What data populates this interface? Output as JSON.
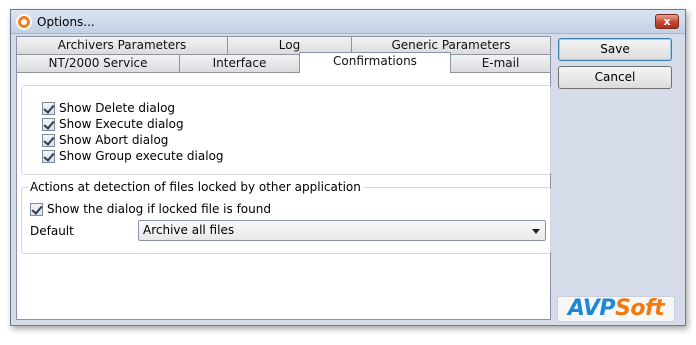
{
  "window": {
    "title": "Options...",
    "close_label": "x"
  },
  "tabs": {
    "row1": [
      "Archivers Parameters",
      "Log",
      "Generic Parameters"
    ],
    "row2": [
      "NT/2000 Service",
      "Interface",
      "Confirmations",
      "E-mail"
    ],
    "active": "Confirmations"
  },
  "confirmations": {
    "options": [
      {
        "label": "Show Delete dialog",
        "checked": true
      },
      {
        "label": "Show Execute dialog",
        "checked": true
      },
      {
        "label": "Show Abort dialog",
        "checked": true
      },
      {
        "label": "Show Group execute dialog",
        "checked": true
      }
    ]
  },
  "locked_files": {
    "legend": "Actions at detection of files locked by other application",
    "show_dialog_label": "Show the dialog if locked file is found",
    "show_dialog_checked": true,
    "default_label": "Default",
    "default_value": "Archive all files"
  },
  "buttons": {
    "save": "Save",
    "cancel": "Cancel"
  },
  "logo": {
    "part1": "AVP",
    "part2": "Soft"
  }
}
